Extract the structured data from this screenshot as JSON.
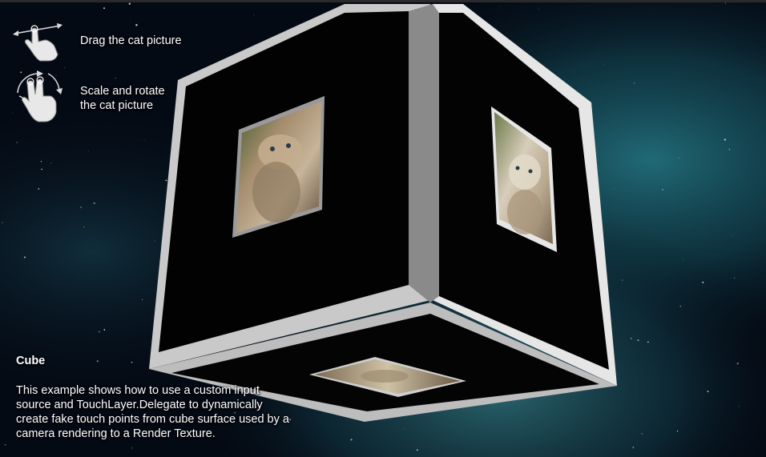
{
  "hints": {
    "drag": {
      "label": "Drag the cat picture",
      "icon": "drag-hand-icon"
    },
    "scale_rotate": {
      "label": "Scale and rotate\nthe cat picture",
      "icon": "rotate-hand-icon"
    }
  },
  "info": {
    "title": "Cube",
    "description": "This example shows how to use a custom input\nsource and TouchLayer.Delegate to dynamically\ncreate fake touch points from cube surface used by a\ncamera rendering to a Render Texture."
  },
  "scene": {
    "cube_face_color": "#000000",
    "cube_border_color": "#d8d8d8",
    "background_colors": [
      "#040a14",
      "#0e2f3c",
      "#1f6e7a"
    ]
  }
}
